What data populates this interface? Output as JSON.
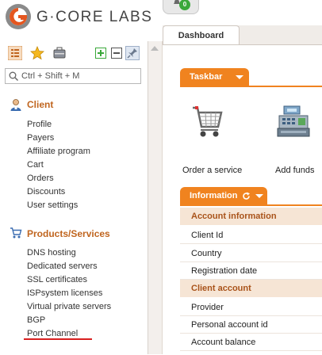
{
  "header": {
    "logo_text": "G·CORE LABS",
    "notification_count": "0"
  },
  "sidebar": {
    "search": {
      "placeholder": "Ctrl + Shift + M"
    },
    "sections": [
      {
        "title": "Client",
        "icon": "user-icon",
        "items": [
          "Profile",
          "Payers",
          "Affiliate program",
          "Cart",
          "Orders",
          "Discounts",
          "User settings"
        ]
      },
      {
        "title": "Products/Services",
        "icon": "cart-icon",
        "items": [
          "DNS hosting",
          "Dedicated servers",
          "SSL certificates",
          "ISPsystem licenses",
          "Virtual private servers",
          "BGP",
          "Port Channel"
        ]
      }
    ]
  },
  "main": {
    "tab_label": "Dashboard",
    "taskbar": {
      "label": "Taskbar",
      "actions": [
        "Order a service",
        "Add funds"
      ]
    },
    "information": {
      "label": "Information",
      "groups": [
        {
          "title": "Account information",
          "rows": [
            "Client Id",
            "Country",
            "Registration date"
          ]
        },
        {
          "title": "Client account",
          "rows": [
            "Provider",
            "Personal account id",
            "Account balance"
          ]
        }
      ]
    }
  },
  "colors": {
    "accent": "#f0831f",
    "section_title": "#c0651f",
    "highlight_underline": "#d82020",
    "info_header_bg": "#f6e5d5"
  }
}
